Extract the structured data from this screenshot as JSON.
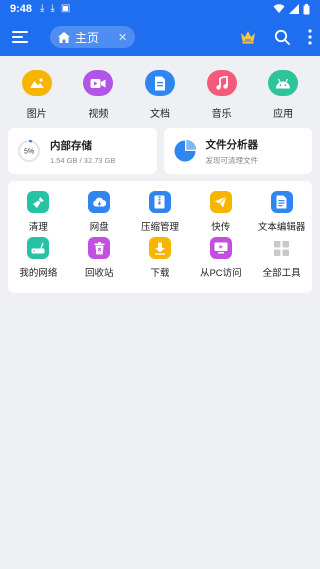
{
  "status_bar": {
    "time": "9:48"
  },
  "app_bar": {
    "home_tab_label": "主页"
  },
  "categories": [
    {
      "label": "图片",
      "icon": "image-icon",
      "color": "#f7b500"
    },
    {
      "label": "视频",
      "icon": "video-icon",
      "color": "#b254e8"
    },
    {
      "label": "文档",
      "icon": "document-icon",
      "color": "#2f86f0"
    },
    {
      "label": "音乐",
      "icon": "music-icon",
      "color": "#f45b7a"
    },
    {
      "label": "应用",
      "icon": "android-icon",
      "color": "#2ec49a"
    }
  ],
  "storage": {
    "title": "内部存储",
    "detail": "1.54 GB / 32.73 GB",
    "percent_label": "5%",
    "used_fraction": 0.05
  },
  "analyzer": {
    "title": "文件分析器",
    "subtitle": "发现可清理文件"
  },
  "tools": [
    {
      "label": "清理",
      "icon": "broom-icon",
      "color": "#26c2a6"
    },
    {
      "label": "网盘",
      "icon": "cloud-icon",
      "color": "#2f86f0"
    },
    {
      "label": "压缩管理",
      "icon": "zip-icon",
      "color": "#2f86f0"
    },
    {
      "label": "快传",
      "icon": "send-icon",
      "color": "#f7b500"
    },
    {
      "label": "文本编辑器",
      "icon": "text-editor-icon",
      "color": "#2f86f0"
    },
    {
      "label": "我的网络",
      "icon": "router-icon",
      "color": "#26c2a6"
    },
    {
      "label": "回收站",
      "icon": "trash-icon",
      "color": "#c24fe0"
    },
    {
      "label": "下载",
      "icon": "download-icon",
      "color": "#f7b500"
    },
    {
      "label": "从PC访问",
      "icon": "pc-access-icon",
      "color": "#c24fe0"
    },
    {
      "label": "全部工具",
      "icon": "grid-icon",
      "color": "#c8c8c8"
    }
  ]
}
